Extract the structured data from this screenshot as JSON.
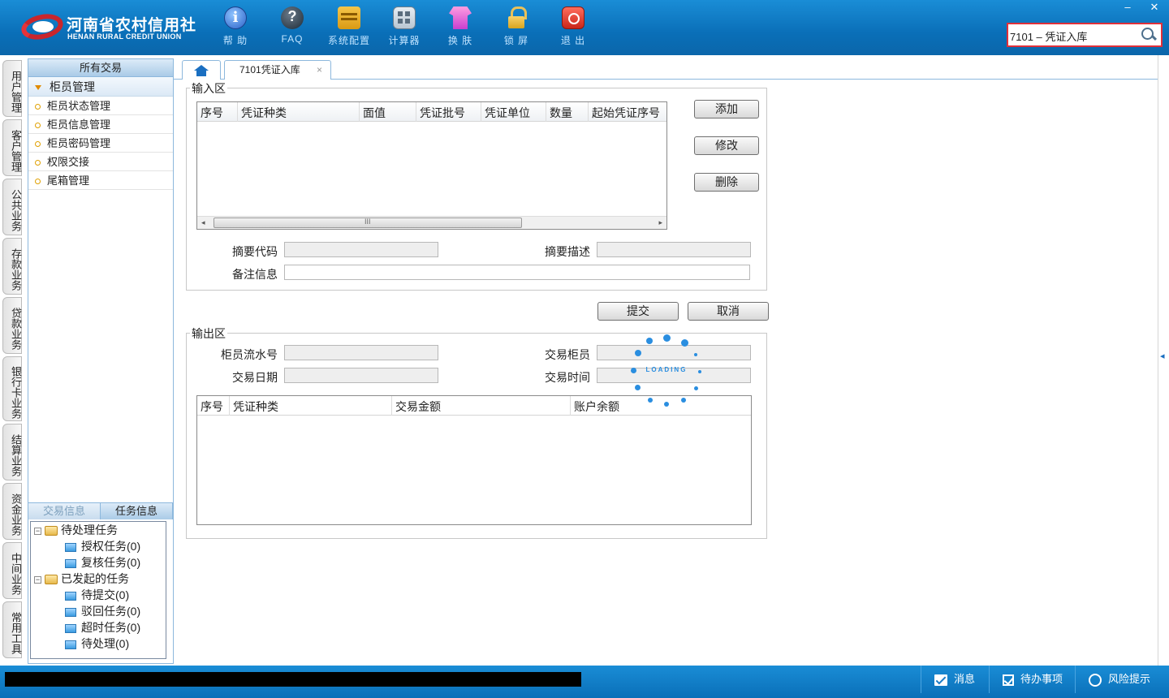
{
  "header": {
    "logo_cn": "河南省农村信用社",
    "logo_en": "HENAN RURAL CREDIT UNION",
    "toolbar": [
      {
        "id": "help",
        "icon": "info-icon",
        "label": "帮 助"
      },
      {
        "id": "faq",
        "icon": "question-icon",
        "label": "FAQ"
      },
      {
        "id": "config",
        "icon": "toolbox-icon",
        "label": "系统配置"
      },
      {
        "id": "calc",
        "icon": "calculator-icon",
        "label": "计算器"
      },
      {
        "id": "skin",
        "icon": "shirt-icon",
        "label": "换 肤"
      },
      {
        "id": "lock",
        "icon": "lock-icon",
        "label": "锁 屏"
      },
      {
        "id": "exit",
        "icon": "power-icon",
        "label": "退 出"
      }
    ],
    "search_value": "7101 – 凭证入库",
    "window_minimize": "–",
    "window_close": "✕"
  },
  "vertical_tabs": [
    "用户管理",
    "客户管理",
    "公共业务",
    "存款业务",
    "贷款业务",
    "银行卡业务",
    "结算业务",
    "资金业务",
    "中间业务",
    "常用工具"
  ],
  "left_panel": {
    "title": "所有交易",
    "group": "柜员管理",
    "items": [
      "柜员状态管理",
      "柜员信息管理",
      "柜员密码管理",
      "权限交接",
      "尾箱管理"
    ],
    "bottom_tabs": [
      "交易信息",
      "任务信息"
    ],
    "tree": [
      {
        "label": "待处理任务",
        "level": 0
      },
      {
        "label": "授权任务(0)",
        "level": 1
      },
      {
        "label": "复核任务(0)",
        "level": 1
      },
      {
        "label": "已发起的任务",
        "level": 0
      },
      {
        "label": "待提交(0)",
        "level": 1
      },
      {
        "label": "驳回任务(0)",
        "level": 1
      },
      {
        "label": "超时任务(0)",
        "level": 1
      },
      {
        "label": "待处理(0)",
        "level": 1
      }
    ],
    "tree_toggle": "−"
  },
  "tabs": {
    "active_label": "7101凭证入库",
    "close_glyph": "×"
  },
  "input_area": {
    "title": "输入区",
    "columns": [
      "序号",
      "凭证种类",
      "面值",
      "凭证批号",
      "凭证单位",
      "数量",
      "起始凭证序号"
    ],
    "buttons": {
      "add": "添加",
      "edit": "修改",
      "delete": "删除"
    },
    "summary_code_label": "摘要代码",
    "summary_desc_label": "摘要描述",
    "remark_label": "备注信息",
    "scroll_left": "◂",
    "scroll_right": "▸",
    "scroll_grip": "III"
  },
  "actions": {
    "submit": "提交",
    "cancel": "取消"
  },
  "output_area": {
    "title": "输出区",
    "teller_serial_label": "柜员流水号",
    "trade_teller_label": "交易柜员",
    "trade_date_label": "交易日期",
    "trade_time_label": "交易时间",
    "columns": [
      "序号",
      "凭证种类",
      "交易金额",
      "账户余额"
    ]
  },
  "loading_text": "LOADING",
  "statusbar": {
    "message": "消息",
    "todo": "待办事项",
    "risk": "风险提示"
  },
  "colors": {
    "header_blue": "#0a6fb8",
    "search_border": "#e0303a",
    "panel_border": "#8db8dd",
    "loading_blue": "#2a8ee0"
  }
}
